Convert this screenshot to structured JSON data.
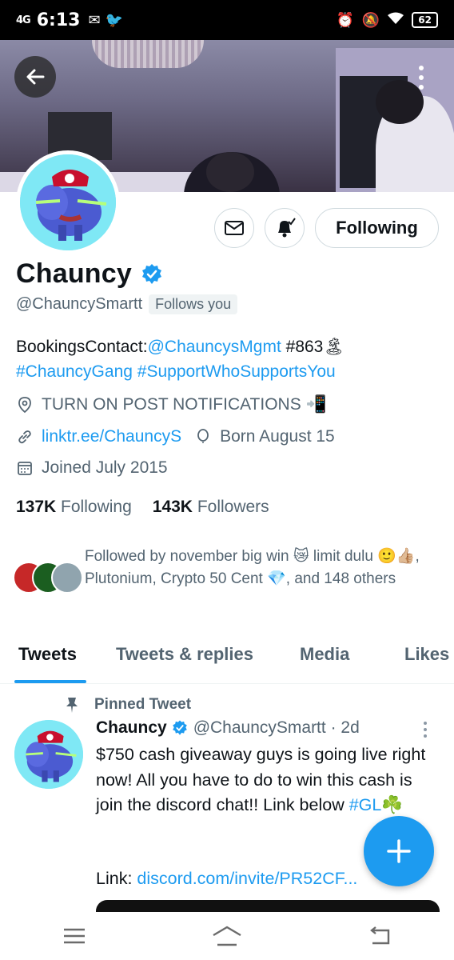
{
  "status_bar": {
    "signal": "4G",
    "time": "6:13",
    "battery": "62"
  },
  "profile": {
    "name": "Chauncy",
    "handle": "@ChauncySmartt",
    "follows_you": "Follows you",
    "following_button": "Following",
    "bio_prefix": "BookingsContact:",
    "bio_mention": "@ChauncysMgmt",
    "bio_tag_863": " #863🏝",
    "bio_hashtag_1": "#ChauncyGang",
    "bio_hashtag_2": "#SupportWhoSupportsYou",
    "location": "TURN ON POST NOTIFICATIONS 📲",
    "website": "linktr.ee/ChauncyS",
    "birthday": "Born August 15",
    "joined": "Joined July 2015",
    "following_count": "137K",
    "following_label": "Following",
    "followers_count": "143K",
    "followers_label": "Followers",
    "followed_by": "Followed by november big win 😿 limit dulu 🙂👍🏼, Plutonium, Crypto 50 Cent 💎, and 148 others"
  },
  "tabs": [
    {
      "label": "Tweets"
    },
    {
      "label": "Tweets & replies"
    },
    {
      "label": "Media"
    },
    {
      "label": "Likes"
    }
  ],
  "pinned_tweet": {
    "pinned_label": "Pinned Tweet",
    "name": "Chauncy",
    "handle_time": "@ChauncySmartt · 2d",
    "body": "$750 cash giveaway guys is going live right now! All you have to do to win this cash is join the discord chat!! Link below ",
    "hashtag": "#GL☘️",
    "link_label": "Link: ",
    "link_url": "discord.com/invite/PR52CF..."
  },
  "colors": {
    "accent": "#1d9bf0",
    "secondary_text": "#536471",
    "primary_text": "#0f1419"
  }
}
